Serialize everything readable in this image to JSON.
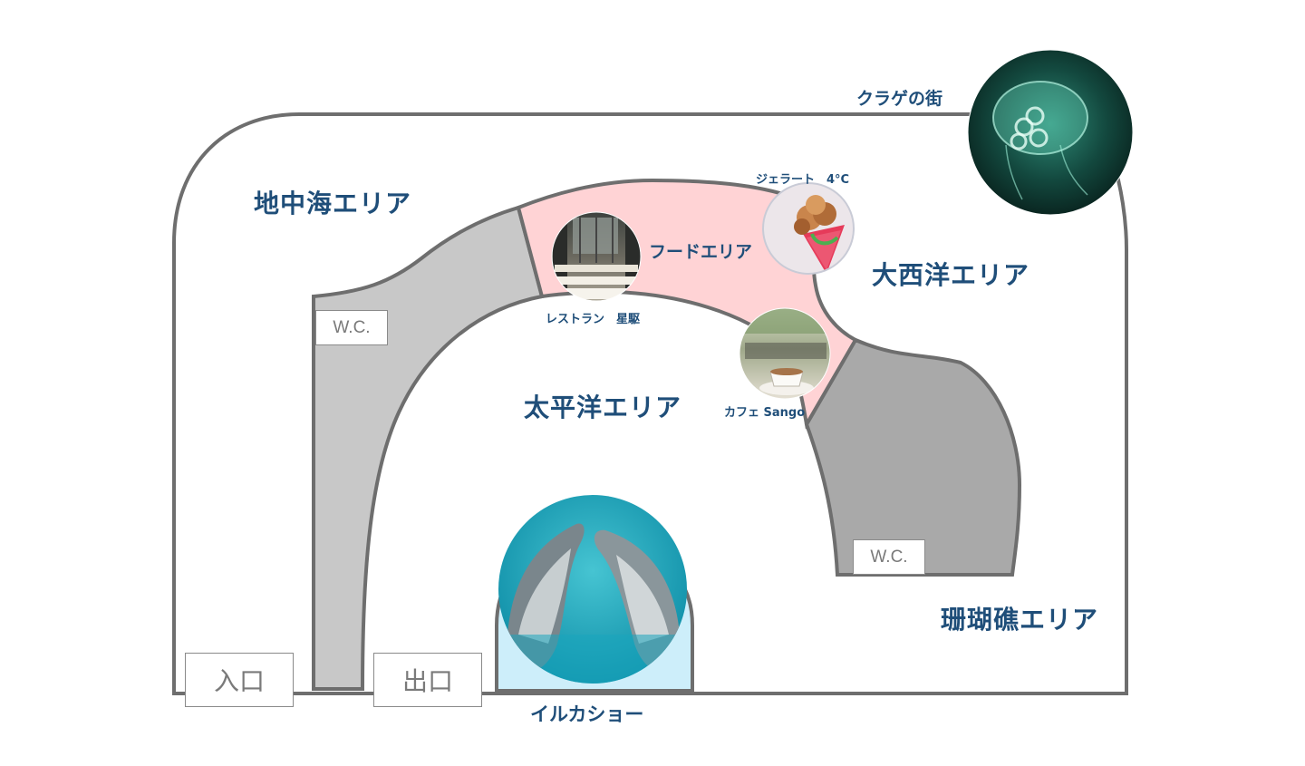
{
  "areas": {
    "mediterranean": "地中海エリア",
    "atlantic": "大西洋エリア",
    "pacific": "太平洋エリア",
    "coral_reef": "珊瑚礁エリア"
  },
  "spots": {
    "food_area": "フードエリア",
    "restaurant": "レストラン　星駆",
    "gelato": "ジェラート　4°C",
    "cafe": "カフェ Sango",
    "jellyfish": "クラゲの街",
    "dolphin_show": "イルカショー"
  },
  "facilities": {
    "wc_left": "W.C.",
    "wc_right": "W.C.",
    "entrance": "入口",
    "exit": "出口"
  },
  "photos": {
    "restaurant": "restaurant-photo",
    "gelato": "gelato-photo",
    "cafe": "cafe-photo",
    "jellyfish": "jellyfish-photo",
    "dolphin": "dolphin-photo"
  },
  "colors": {
    "outline": "#6e6e6e",
    "walkway_left": "#c8c8c8",
    "walkway_right": "#a9a9a9",
    "food_zone": "#ffd3d5",
    "dolphin_pool": "#cdeefa",
    "label": "#1f4e79"
  }
}
